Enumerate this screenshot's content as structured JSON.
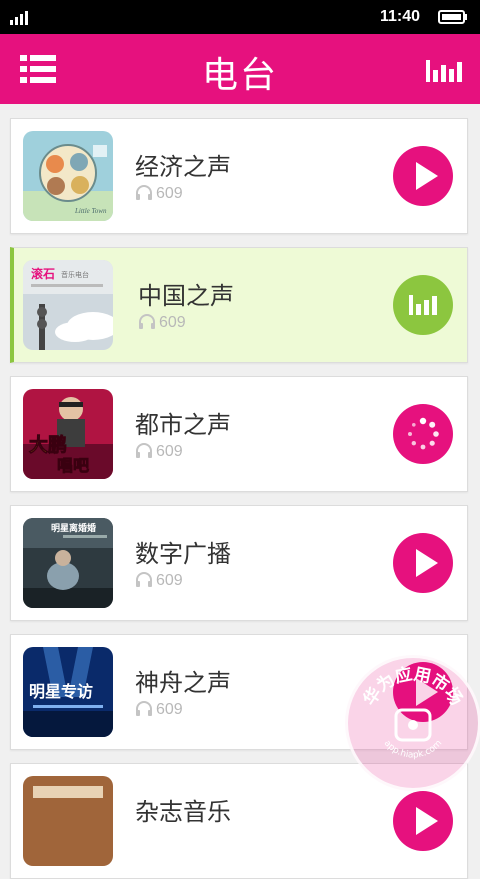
{
  "status_bar": {
    "time": "11:40"
  },
  "header": {
    "title": "电台"
  },
  "stations": [
    {
      "name": "经济之声",
      "listeners": "609",
      "state": "play"
    },
    {
      "name": "中国之声",
      "listeners": "609",
      "state": "playing"
    },
    {
      "name": "都市之声",
      "listeners": "609",
      "state": "loading"
    },
    {
      "name": "数字广播",
      "listeners": "609",
      "state": "play"
    },
    {
      "name": "神舟之声",
      "listeners": "609",
      "state": "play"
    },
    {
      "name": "杂志音乐",
      "listeners": "",
      "state": "play"
    }
  ],
  "thumb_text": {
    "s1": "Little Town",
    "s2_title": "滚石",
    "s2_sub": "音乐电台",
    "s3_a": "大鹏",
    "s3_b": "唱吧",
    "s4": "明星离婚婚",
    "s5": "明星专访"
  },
  "watermark": {
    "text": "华为应用市场",
    "url": "app.hiapk.com"
  },
  "colors": {
    "accent": "#e6117e",
    "active": "#8cc63f",
    "active_bg": "#eefad6"
  }
}
